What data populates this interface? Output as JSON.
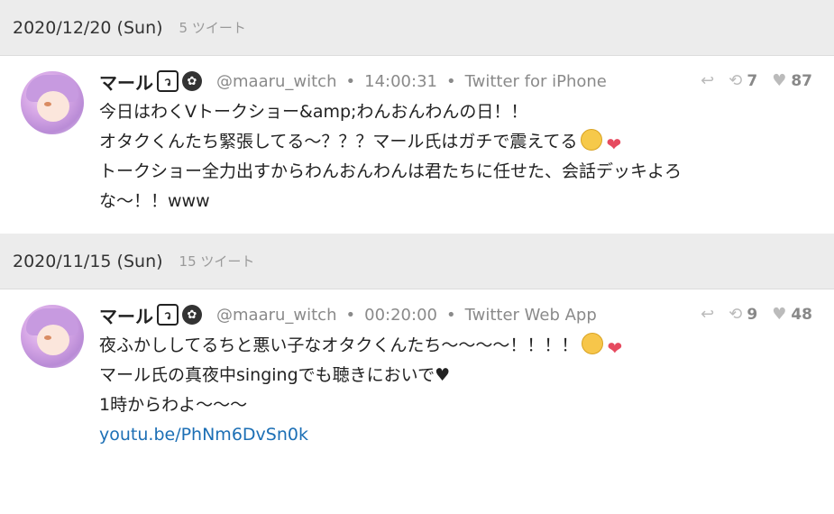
{
  "days": [
    {
      "date": "2020/12/20 (Sun)",
      "count": "5 ツイート",
      "tweet": {
        "name": "マール",
        "handle": "@maaru_witch",
        "time": "14:00:31",
        "via": "Twitter for iPhone",
        "retweets": "7",
        "likes": "87",
        "lines": [
          "今日はわくVトークショー&amp;わんおんわんの日！！",
          "オタクくんたち緊張してる〜？？？マール氏はガチで震えてる",
          "トークショー全力出すからわんおんわんは君たちに任せた、会話デッキよろ",
          "な〜！！www"
        ]
      }
    },
    {
      "date": "2020/11/15 (Sun)",
      "count": "15 ツイート",
      "tweet": {
        "name": "マール",
        "handle": "@maaru_witch",
        "time": "00:20:00",
        "via": "Twitter Web App",
        "retweets": "9",
        "likes": "48",
        "lines": [
          "夜ふかししてるちと悪い子なオタクくんたち〜〜〜〜！！！！",
          "マール氏の真夜中singingでも聴きにおいで♥",
          "1時からわよ〜〜〜"
        ],
        "link": "youtu.be/PhNm6DvSn0k"
      }
    }
  ],
  "icons": {
    "reply": "reply-icon",
    "retweet": "retweet-icon",
    "like": "heart-icon"
  }
}
